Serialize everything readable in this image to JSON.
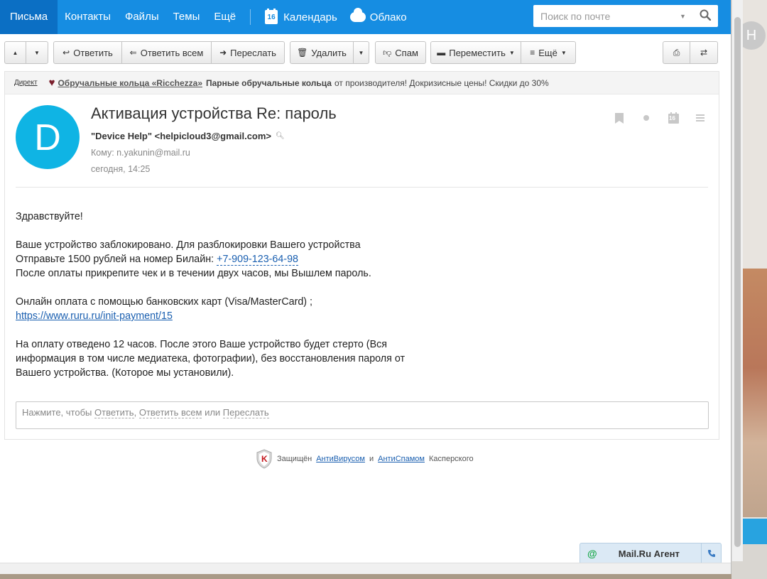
{
  "topnav": {
    "items": [
      {
        "label": "Письма",
        "active": true
      },
      {
        "label": "Контакты"
      },
      {
        "label": "Файлы"
      },
      {
        "label": "Темы"
      },
      {
        "label": "Ещё"
      }
    ],
    "calendar_day": "16",
    "calendar_label": "Календарь",
    "cloud_label": "Облако",
    "search_placeholder": "Поиск по почте"
  },
  "desktop": {
    "avatar_letter": "Н"
  },
  "toolbar": {
    "reply": "Ответить",
    "reply_all": "Ответить всем",
    "forward": "Переслать",
    "delete": "Удалить",
    "spam": "Спам",
    "move": "Переместить",
    "more": "Ещё"
  },
  "ad": {
    "direct": "Директ",
    "link": "Обручальные кольца «Ricchezza»",
    "bold": "Парные обручальные кольца",
    "rest": "от производителя! Докризисные цены! Скидки до 30%"
  },
  "message": {
    "avatar_letter": "D",
    "subject": "Активация устройства Re: пароль",
    "from": "\"Device Help\" <helpicloud3@gmail.com>",
    "to": "Кому: n.yakunin@mail.ru",
    "date": "сегодня, 14:25",
    "calendar_day": "16",
    "body": {
      "greeting": "Здравствуйте!",
      "p1_l1": "Ваше устройство заблокировано. Для разблокировки Вашего устройства",
      "p1_l2": "Отправьте 1500 рублей на номер Билайн:",
      "p1_phone": "+7-909-123-64-98",
      "p1_l3": "После оплаты прикрепите чек и в течении двух часов, мы Вышлем пароль.",
      "p2_l1": "Онлайн оплата с помощью банковских карт (Visa/MasterCard) ;",
      "p2_url": "https://www.ruru.ru/init-payment/15",
      "p3_l1": "На оплату отведено 12 часов. После этого Ваше устройство будет стерто (Вся",
      "p3_l2": "информация в том числе медиатека, фотографии), без восстановления пароля от",
      "p3_l3": "Вашего устройства. (Которое мы установили)."
    },
    "quick_reply": {
      "prefix": "Нажмите, чтобы",
      "reply": "Ответить",
      "reply_all": "Ответить всем",
      "or": "или",
      "forward": "Переслать"
    }
  },
  "footer": {
    "prefix": "Защищён",
    "antivirus": "АнтиВирусом",
    "and": "и",
    "antispam": "АнтиСпамом",
    "suffix": "Касперского"
  },
  "agent": {
    "label": "Mail.Ru Агент"
  },
  "colors": {
    "brand": "#168de2",
    "active_tab": "#0b6fc4",
    "avatar": "#0fb4e4",
    "link": "#1a5fb0"
  }
}
